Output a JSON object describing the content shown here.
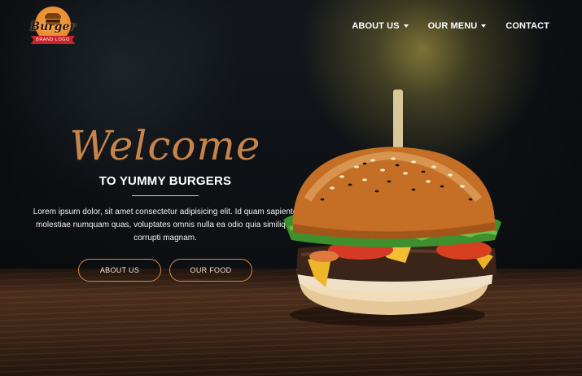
{
  "logo": {
    "title": "Burger",
    "ribbon": "BRAND LOGO"
  },
  "nav": {
    "items": [
      {
        "label": "ABOUT US",
        "dropdown": true
      },
      {
        "label": "OUR MENU",
        "dropdown": true
      },
      {
        "label": "CONTACT",
        "dropdown": false
      }
    ]
  },
  "hero": {
    "welcome": "Welcome",
    "subtitle": "TO YUMMY BURGERS",
    "description": "Lorem ipsum dolor, sit amet consectetur adipisicing elit. Id quam sapiente molestiae numquam quas, voluptates omnis nulla ea odio quia similique corrupti magnam.",
    "buttons": [
      {
        "label": "ABOUT US"
      },
      {
        "label": "OUR FOOD"
      }
    ]
  },
  "colors": {
    "accent": "#c7834a",
    "button_border": "#d6894a",
    "ribbon": "#c8242a"
  },
  "icons": [
    "chevron-down-icon",
    "burger-logo-icon"
  ]
}
